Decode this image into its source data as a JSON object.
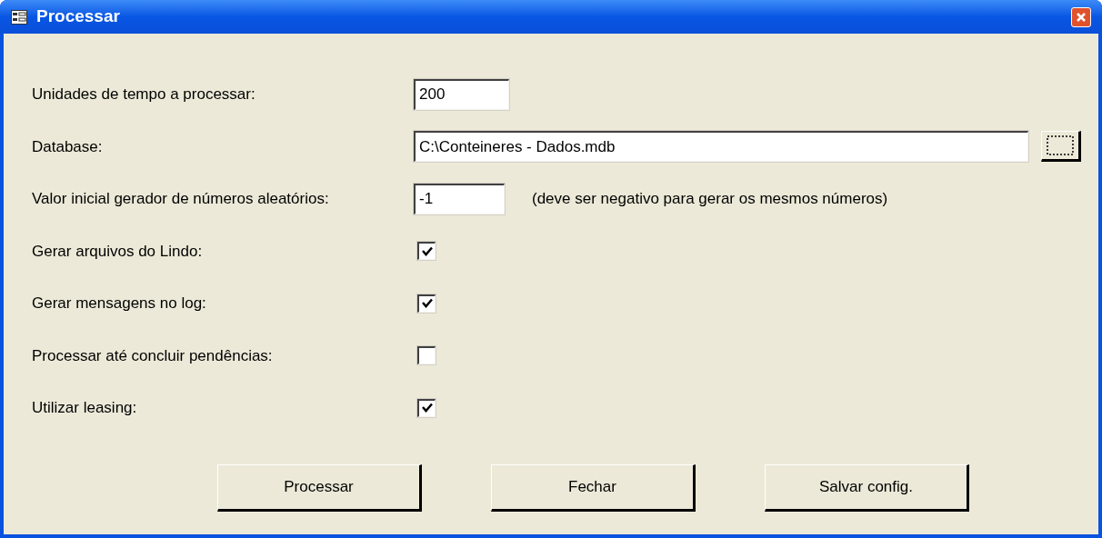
{
  "window": {
    "title": "Processar"
  },
  "rows": [
    {
      "kind": "text",
      "label": "Unidades de tempo a processar:",
      "value": "200"
    },
    {
      "kind": "browse",
      "label": "Database:",
      "value": "C:\\Conteineres - Dados.mdb"
    },
    {
      "kind": "hint",
      "label": "Valor inicial gerador de números aleatórios:",
      "value": "-1",
      "hint": "(deve ser negativo para gerar os mesmos números)"
    },
    {
      "kind": "checkbox",
      "label": "Gerar arquivos do Lindo:",
      "checked": true
    },
    {
      "kind": "checkbox",
      "label": "Gerar mensagens no log:",
      "checked": true
    },
    {
      "kind": "checkbox",
      "label": "Processar até concluir pendências:",
      "checked": false
    },
    {
      "kind": "checkbox",
      "label": "Utilizar leasing:",
      "checked": true
    }
  ],
  "buttons": [
    "Processar",
    "Fechar",
    "Salvar config."
  ]
}
